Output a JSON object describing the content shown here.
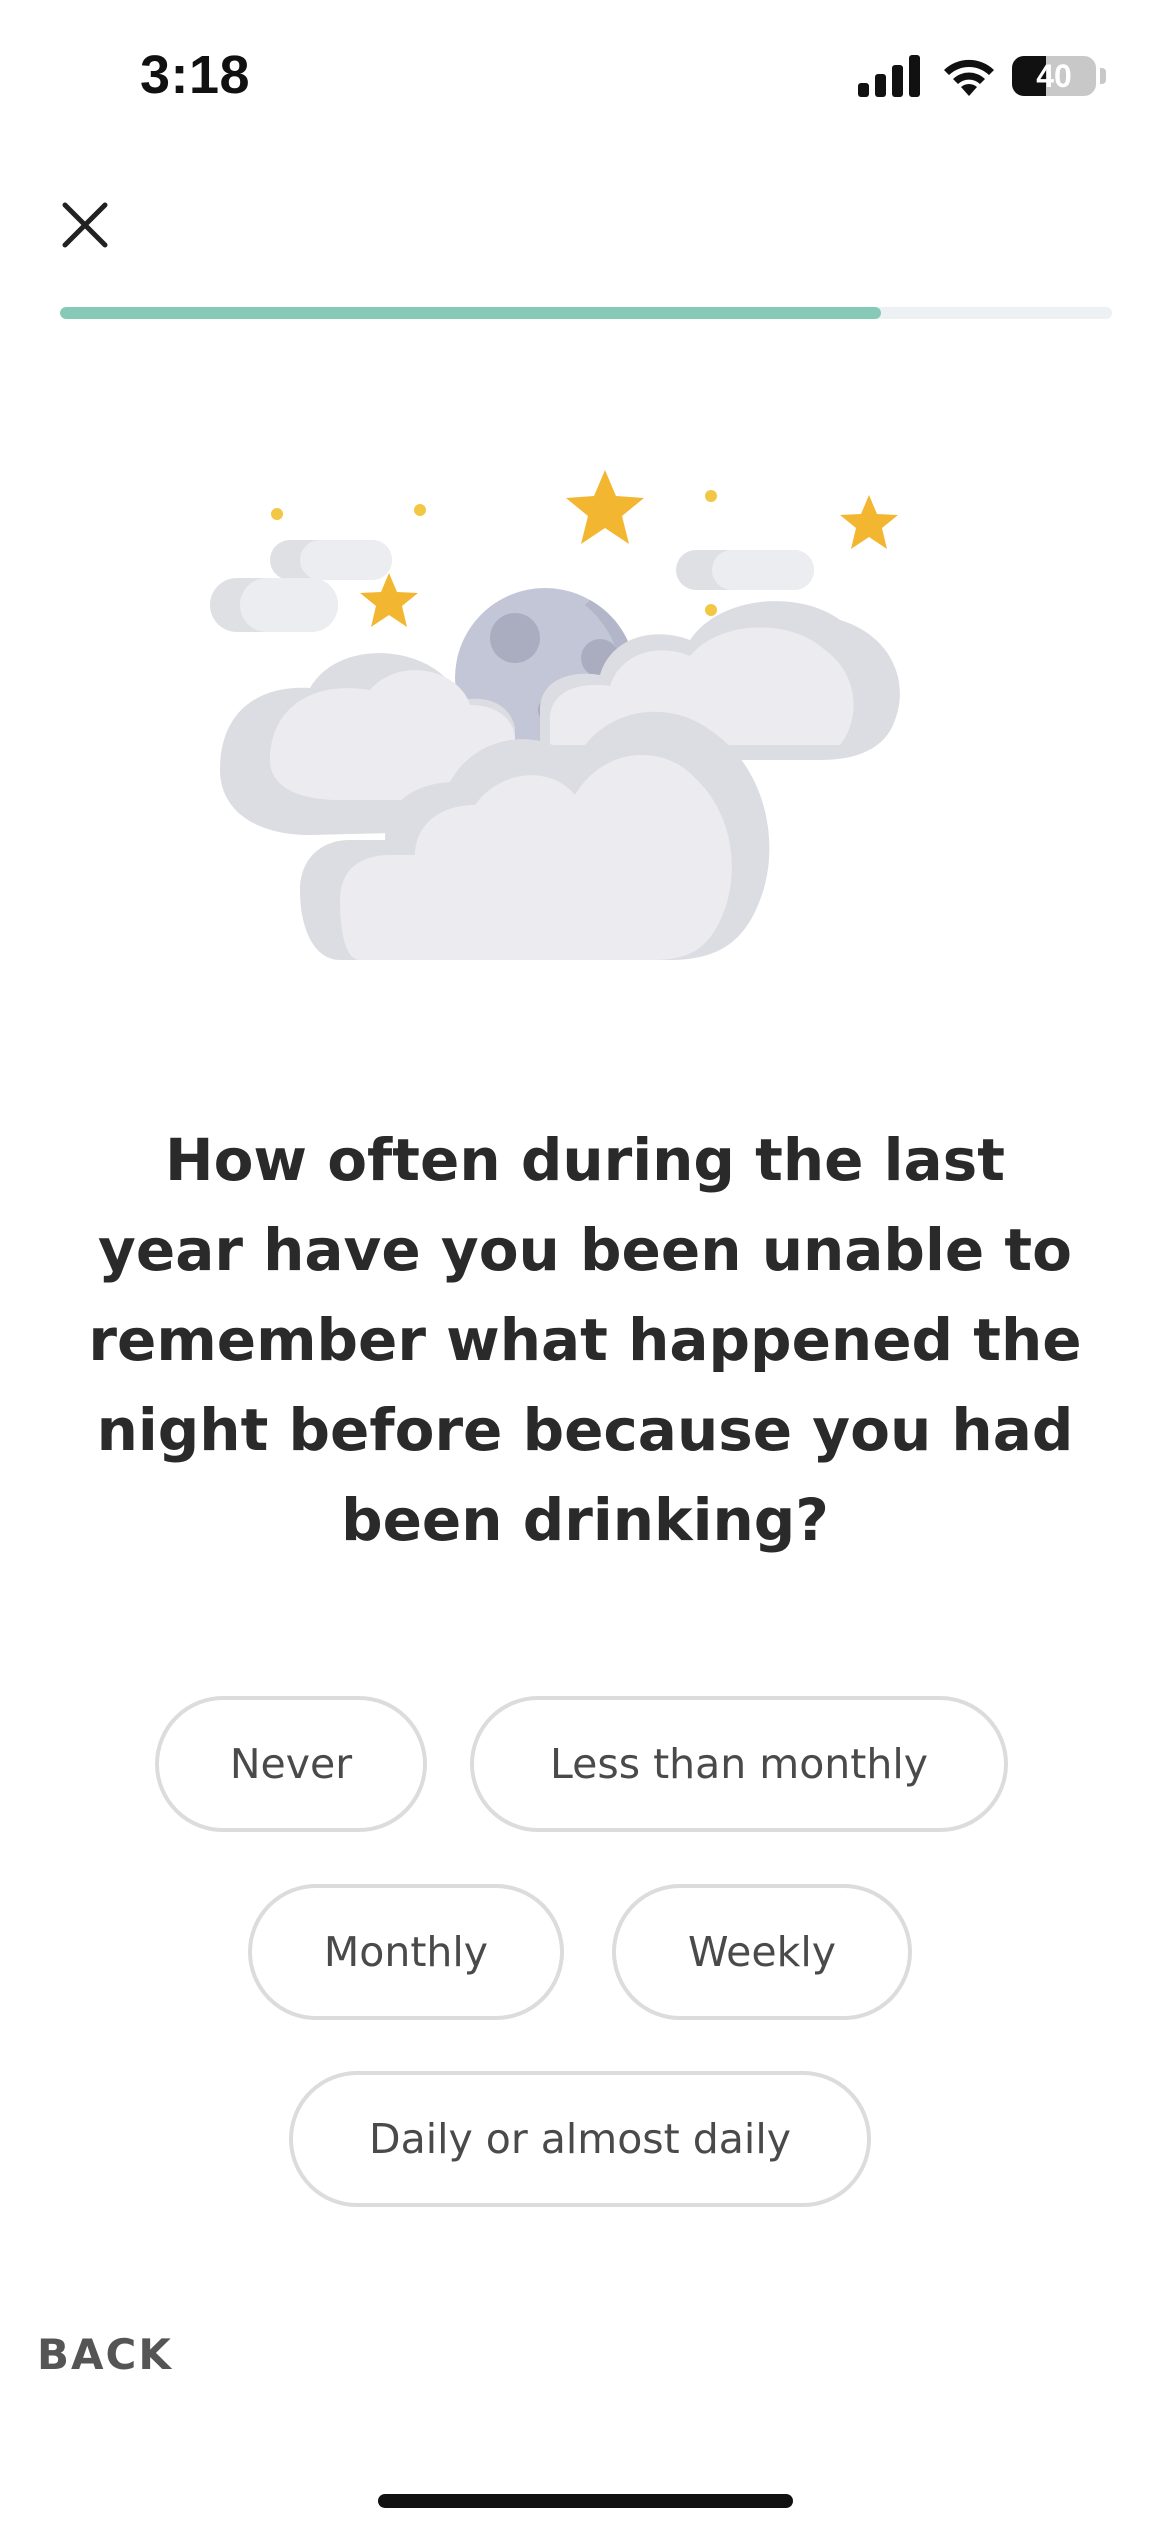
{
  "status_bar": {
    "time": "3:18",
    "battery_level": "40",
    "battery_fraction": 0.4
  },
  "header": {
    "close_icon": "close-icon",
    "progress_fraction": 0.78,
    "progress_color": "#86c9b6"
  },
  "illustration": {
    "icon": "moon-clouds-stars-illustration"
  },
  "question": {
    "text": "How often during the last year have you been unable to remember what happened the night before because you had been drinking?"
  },
  "options": [
    {
      "label": "Never"
    },
    {
      "label": "Less than monthly"
    },
    {
      "label": "Monthly"
    },
    {
      "label": "Weekly"
    },
    {
      "label": "Daily or almost daily"
    }
  ],
  "footer": {
    "back_label": "BACK"
  }
}
